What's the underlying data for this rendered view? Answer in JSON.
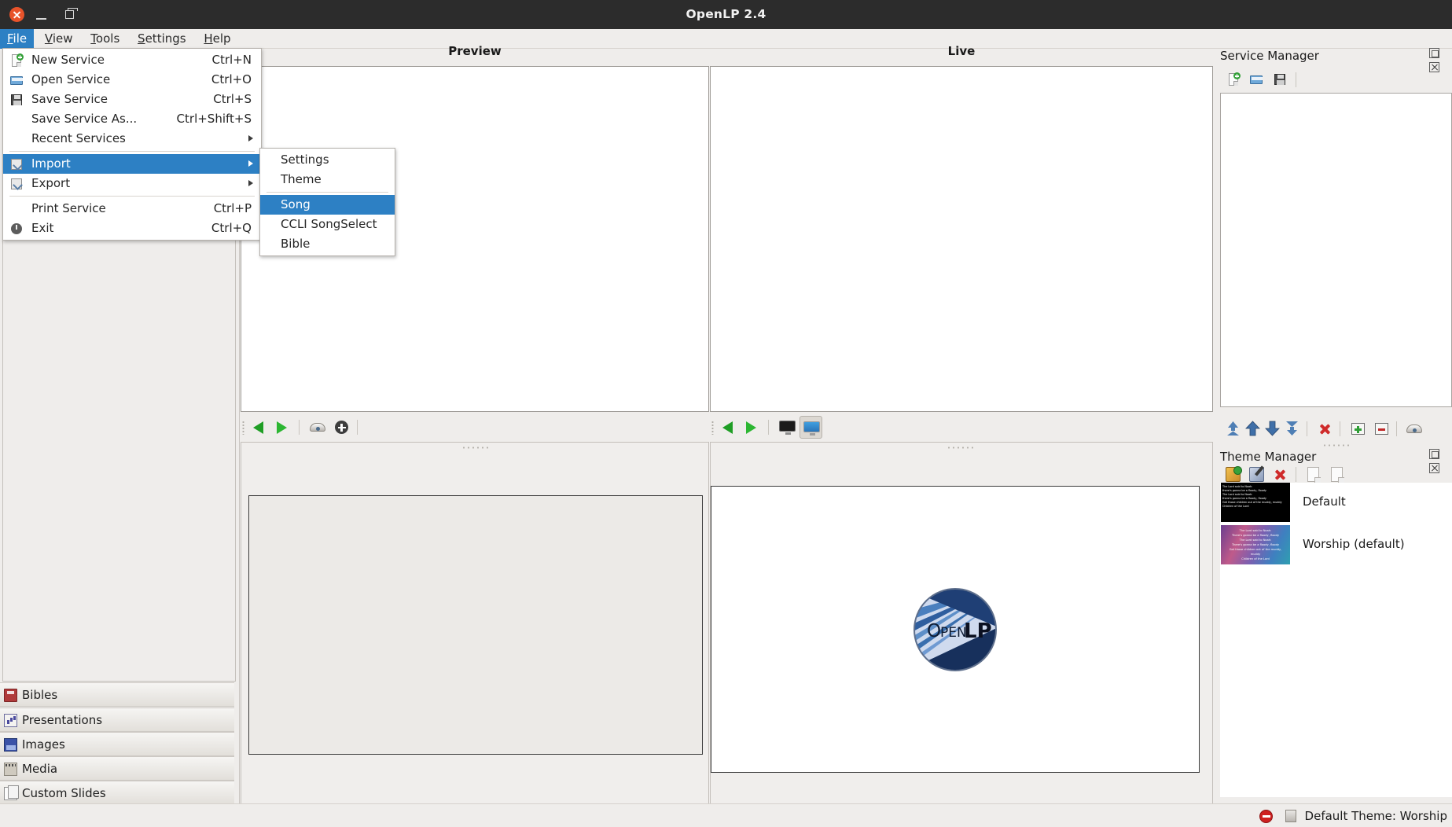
{
  "window": {
    "title": "OpenLP 2.4",
    "controls": {
      "close": "close-button",
      "minimize": "minimize-button",
      "maximize": "maximize-button"
    }
  },
  "menubar": {
    "items": [
      {
        "label": "File",
        "mnemonic": "F",
        "active": true
      },
      {
        "label": "View",
        "mnemonic": "V",
        "active": false
      },
      {
        "label": "Tools",
        "mnemonic": "T",
        "active": false
      },
      {
        "label": "Settings",
        "mnemonic": "S",
        "active": false
      },
      {
        "label": "Help",
        "mnemonic": "H",
        "active": false
      }
    ]
  },
  "file_menu": {
    "items": [
      {
        "label": "New Service",
        "accel": "Ctrl+N",
        "icon": "new-document-icon",
        "submenu": false,
        "selected": false
      },
      {
        "label": "Open Service",
        "accel": "Ctrl+O",
        "icon": "open-folder-icon",
        "submenu": false,
        "selected": false
      },
      {
        "label": "Save Service",
        "accel": "Ctrl+S",
        "icon": "floppy-disk-icon",
        "submenu": false,
        "selected": false
      },
      {
        "label": "Save Service As...",
        "accel": "Ctrl+Shift+S",
        "icon": "none",
        "submenu": false,
        "selected": false
      },
      {
        "label": "Recent Services",
        "accel": "",
        "icon": "none",
        "submenu": true,
        "selected": false
      },
      {
        "label": "Import",
        "accel": "",
        "icon": "import-icon",
        "submenu": true,
        "selected": true
      },
      {
        "label": "Export",
        "accel": "",
        "icon": "export-icon",
        "submenu": true,
        "selected": false
      },
      {
        "label": "Print Service",
        "accel": "Ctrl+P",
        "icon": "none",
        "submenu": false,
        "selected": false
      },
      {
        "label": "Exit",
        "accel": "Ctrl+Q",
        "icon": "power-icon",
        "submenu": false,
        "selected": false
      }
    ]
  },
  "import_menu": {
    "items": [
      {
        "label": "Settings",
        "selected": false
      },
      {
        "label": "Theme",
        "selected": false
      },
      {
        "label": "Song",
        "selected": true
      },
      {
        "label": "CCLI SongSelect",
        "selected": false
      },
      {
        "label": "Bible",
        "selected": false
      }
    ]
  },
  "sidebar": {
    "items": [
      {
        "label": "Bibles",
        "icon": "bible-icon"
      },
      {
        "label": "Presentations",
        "icon": "presentation-icon"
      },
      {
        "label": "Images",
        "icon": "image-icon"
      },
      {
        "label": "Media",
        "icon": "media-icon"
      },
      {
        "label": "Custom Slides",
        "icon": "custom-slide-icon"
      }
    ]
  },
  "preview_pane": {
    "title": "Preview",
    "toolbar": [
      {
        "name": "previous-slide-button",
        "icon": "triangle-left-icon"
      },
      {
        "name": "next-slide-button",
        "icon": "triangle-right-icon"
      },
      {
        "name": "blank-screen-button",
        "icon": "blank-screen-icon"
      },
      {
        "name": "go-live-button",
        "icon": "circle-plus-icon"
      }
    ]
  },
  "live_pane": {
    "title": "Live",
    "toolbar": [
      {
        "name": "previous-slide-button",
        "icon": "triangle-left-icon",
        "pressed": false
      },
      {
        "name": "next-slide-button",
        "icon": "triangle-right-icon",
        "pressed": false
      },
      {
        "name": "blank-to-screen-button",
        "icon": "black-monitor-icon",
        "pressed": false
      },
      {
        "name": "show-desktop-button",
        "icon": "blue-monitor-icon",
        "pressed": true
      }
    ],
    "logo_text": "OpenLP"
  },
  "service_manager": {
    "title": "Service Manager",
    "toolbar": [
      {
        "name": "new-service-button",
        "icon": "new-document-icon"
      },
      {
        "name": "open-service-button",
        "icon": "open-folder-icon"
      },
      {
        "name": "save-service-button",
        "icon": "floppy-disk-icon"
      }
    ],
    "bottom_toolbar": [
      {
        "name": "move-to-top-button",
        "icon": "move-top-icon"
      },
      {
        "name": "move-up-button",
        "icon": "arrow-up-icon"
      },
      {
        "name": "move-down-button",
        "icon": "arrow-down-icon"
      },
      {
        "name": "move-to-bottom-button",
        "icon": "move-bottom-icon"
      },
      {
        "name": "delete-item-button",
        "icon": "red-x-icon"
      },
      {
        "name": "expand-all-button",
        "icon": "plus-box-icon"
      },
      {
        "name": "collapse-all-button",
        "icon": "minus-box-icon"
      },
      {
        "name": "toggle-blank-button",
        "icon": "blank-screen-icon"
      }
    ],
    "items": []
  },
  "theme_manager": {
    "title": "Theme Manager",
    "toolbar": [
      {
        "name": "new-theme-button",
        "icon": "new-theme-icon"
      },
      {
        "name": "edit-theme-button",
        "icon": "edit-theme-icon"
      },
      {
        "name": "delete-theme-button",
        "icon": "red-x-icon"
      },
      {
        "name": "import-theme-button",
        "icon": "import-icon"
      },
      {
        "name": "export-theme-button",
        "icon": "export-icon"
      }
    ],
    "themes": [
      {
        "label": "Default",
        "style": "dark",
        "preview_lines": [
          "The Lord said to Noah:",
          "there's gonna be a floody, floody",
          "The Lord said to Noah:",
          "there's gonna be a floody, floody",
          "Get those children out of the muddy, muddy",
          "Children of the Lord"
        ]
      },
      {
        "label": "Worship (default)",
        "style": "worship",
        "preview_lines": [
          "The Lord said to Noah:",
          "There's gonna be a floody, floody",
          "The Lord said to Noah:",
          "There's gonna be a floody, floody",
          "Get those children out of the muddy,",
          "muddy",
          "Children of the Lord"
        ]
      }
    ]
  },
  "statusbar": {
    "stop_icon": "stop-icon",
    "monitor_icon": "monitor-icon",
    "text": "Default Theme: Worship"
  },
  "colors": {
    "accent": "#2d80c4",
    "titlebar_bg": "#2c2c2c",
    "chrome_bg": "#efedeb",
    "panel_border": "#c3bfba",
    "danger": "#cf2a2a",
    "success": "#35a13a"
  }
}
